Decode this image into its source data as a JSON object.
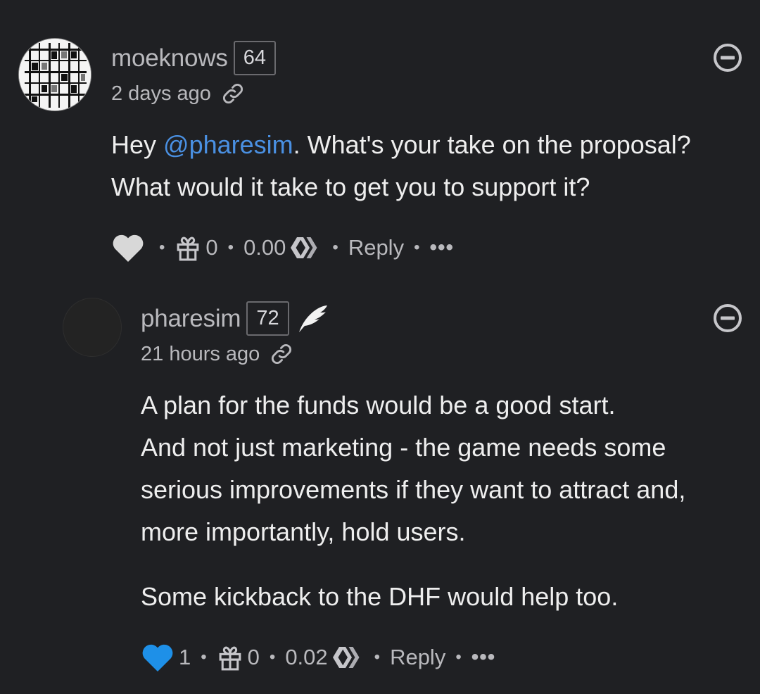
{
  "comments": [
    {
      "username": "moeknows",
      "reputation": "64",
      "time": "2 days ago",
      "body_lines": [
        "Hey @pharesim. What's your take on the proposal?",
        "What would it take to get you to support it?"
      ],
      "mention": "@pharesim",
      "body_pre": "Hey ",
      "body_post": ". What's your take on the proposal?",
      "body_line2": "What would it take to get you to support it?",
      "votes": "",
      "tips": "0",
      "payout": "0.00",
      "reply_label": "Reply",
      "more_label": "•••",
      "vote_color": "#d8d8d8"
    },
    {
      "username": "pharesim",
      "reputation": "72",
      "time": "21 hours ago",
      "paragraph1": [
        "A plan for the funds would be a good start.",
        "And not just marketing - the game needs some",
        "serious improvements if they want to attract and,",
        "more importantly, hold users."
      ],
      "paragraph2": "Some kickback to the DHF would help too.",
      "votes": "1",
      "tips": "0",
      "payout": "0.02",
      "reply_label": "Reply",
      "more_label": "•••",
      "vote_color": "#1e90e8"
    }
  ],
  "colors": {
    "background": "#1f2023",
    "mention": "#4a90e2",
    "upvoted": "#1e90e8"
  },
  "icons": [
    "link-icon",
    "minus-circle-icon",
    "heart-icon",
    "gift-icon",
    "hive-logo-icon",
    "feather-icon"
  ]
}
